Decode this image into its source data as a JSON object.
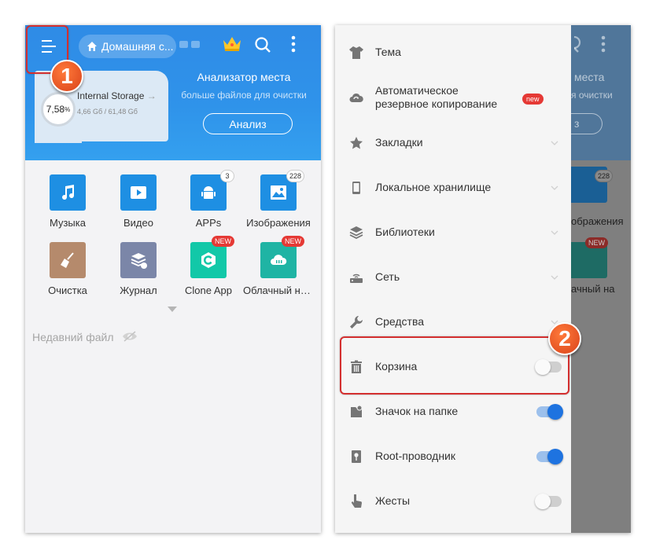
{
  "left_screen": {
    "header": {
      "home_label": "Домашняя с...",
      "menu_icon": "menu-icon",
      "home_icon": "home-icon",
      "crown_icon": "crown-icon",
      "search_icon": "search-icon",
      "more_icon": "more-vert-icon",
      "accent_color": "#2f8be6"
    },
    "storage": {
      "percent": "7,58",
      "percent_sign": "%",
      "name": "Internal Storage",
      "size": "4,66 Gб / 61,48 Gб"
    },
    "analyzer": {
      "title": "Анализатор места",
      "subtitle": "больше файлов для очистки",
      "button": "Анализ"
    },
    "grid": [
      {
        "label": "Музыка",
        "icon": "music-icon",
        "color": "#1e8fe3"
      },
      {
        "label": "Видео",
        "icon": "video-icon",
        "color": "#1e8fe3"
      },
      {
        "label": "APPs",
        "icon": "android-icon",
        "color": "#1e8fe3",
        "count": "3"
      },
      {
        "label": "Изображения",
        "icon": "image-icon",
        "color": "#1e8fe3",
        "count": "228"
      },
      {
        "label": "Очистка",
        "icon": "broom-icon",
        "color": "#b58a6c"
      },
      {
        "label": "Журнал",
        "icon": "history-icon",
        "color": "#7b86a8"
      },
      {
        "label": "Clone App",
        "icon": "clone-icon",
        "color": "#12c8a8",
        "badge": "NEW"
      },
      {
        "label": "Облачный на...",
        "icon": "cloud-icon",
        "color": "#1fb4a4",
        "badge": "NEW"
      }
    ],
    "recent_label": "Недавний файл",
    "step_badge": "1"
  },
  "right_screen": {
    "background_text": {
      "analyzer_title": "места",
      "analyzer_subtitle": "я очистки",
      "analyze_button": "з",
      "images_label": "ображения",
      "cloud_label": "ачный на",
      "images_count": "228",
      "new_badge": "NEW"
    },
    "drawer": [
      {
        "label": "Тема",
        "icon": "shirt-icon"
      },
      {
        "label": "Автоматическое резервное копирование",
        "line1": "Автоматическое",
        "line2": "резервное копирование",
        "icon": "cloud-backup-icon",
        "badge": "new"
      },
      {
        "label": "Закладки",
        "icon": "star-icon",
        "control": "chevron"
      },
      {
        "label": "Локальное хранилище",
        "icon": "phone-icon",
        "control": "chevron"
      },
      {
        "label": "Библиотеки",
        "icon": "layers-icon",
        "control": "chevron"
      },
      {
        "label": "Сеть",
        "icon": "router-icon",
        "control": "chevron"
      },
      {
        "label": "Средства",
        "icon": "wrench-icon",
        "control": "chevron"
      },
      {
        "label": "Корзина",
        "icon": "trash-icon",
        "control": "toggle",
        "state": "off"
      },
      {
        "label": "Значок на папке",
        "icon": "folder-badge-icon",
        "control": "toggle",
        "state": "on"
      },
      {
        "label": "Root-проводник",
        "icon": "key-icon",
        "control": "toggle",
        "state": "on"
      },
      {
        "label": "Жесты",
        "icon": "gesture-icon",
        "control": "toggle",
        "state": "off"
      }
    ],
    "step_badge": "2"
  }
}
